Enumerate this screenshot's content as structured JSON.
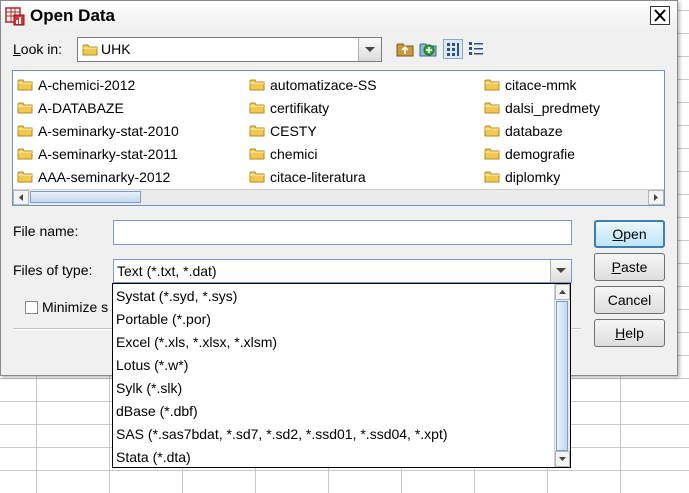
{
  "dialog": {
    "title": "Open Data",
    "close_glyph": "X"
  },
  "look_in": {
    "label": "Look in:",
    "value": "UHK",
    "icon": "folder-icon"
  },
  "toolbar": {
    "icons": [
      "up-folder-icon",
      "new-folder-icon",
      "list-view-icon",
      "details-view-icon"
    ]
  },
  "files": [
    {
      "name": "A-chemici-2012"
    },
    {
      "name": "A-DATABAZE"
    },
    {
      "name": "A-seminarky-stat-2010"
    },
    {
      "name": "A-seminarky-stat-2011"
    },
    {
      "name": "AAA-seminarky-2012"
    },
    {
      "name": "automatizace-SS"
    },
    {
      "name": "certifikaty"
    },
    {
      "name": "CESTY"
    },
    {
      "name": "chemici"
    },
    {
      "name": "citace-literatura"
    },
    {
      "name": "citace-mmk"
    },
    {
      "name": "dalsi_predmety"
    },
    {
      "name": "databaze"
    },
    {
      "name": "demografie"
    },
    {
      "name": "diplomky"
    }
  ],
  "file_name": {
    "label": "File name:",
    "value": ""
  },
  "files_of_type": {
    "label": "Files of type:",
    "value": "Text (*.txt, *.dat)",
    "options": [
      "Systat (*.syd, *.sys)",
      "Portable (*.por)",
      "Excel (*.xls, *.xlsx, *.xlsm)",
      "Lotus (*.w*)",
      "Sylk (*.slk)",
      "dBase (*.dbf)",
      "SAS (*.sas7bdat, *.sd7, *.sd2, *.ssd01, *.ssd04, *.xpt)",
      "Stata (*.dta)"
    ]
  },
  "minimize": {
    "label_visible": "Minimize s",
    "checked": false
  },
  "buttons": {
    "open": {
      "hotkey": "O",
      "rest": "pen"
    },
    "paste": {
      "hotkey": "P",
      "rest": "aste"
    },
    "cancel": {
      "label": "Cancel"
    },
    "help": {
      "hotkey": "H",
      "rest": "elp"
    }
  },
  "colors": {
    "accent": "#3c7fb1",
    "folder": "#f2c94c",
    "list_border": "#6b94c9"
  }
}
